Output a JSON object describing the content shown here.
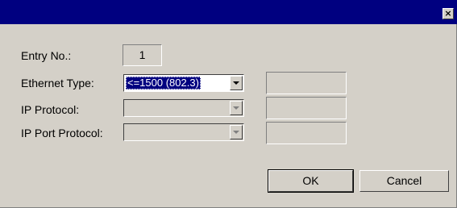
{
  "titlebar": {
    "close_icon": "close-icon",
    "close_glyph": "×"
  },
  "form": {
    "entry_label": "Entry No.:",
    "entry_value": "1",
    "ethernet_label": "Ethernet Type:",
    "ethernet_value": "<=1500 (802.3)",
    "ip_protocol_label": "IP Protocol:",
    "ip_protocol_value": "",
    "ip_port_label": "IP Port Protocol:",
    "ip_port_value": ""
  },
  "buttons": {
    "ok": "OK",
    "cancel": "Cancel"
  },
  "colors": {
    "titlebar": "#000080",
    "face": "#d4d0c8",
    "selection": "#000080"
  }
}
